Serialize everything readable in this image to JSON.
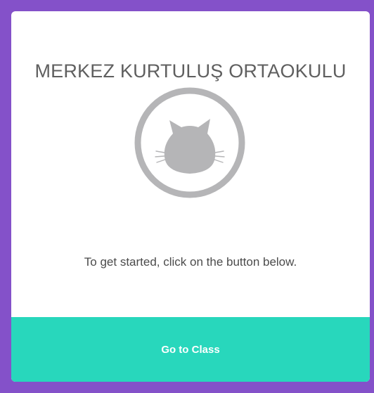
{
  "card": {
    "school_name": "MERKEZ KURTULUŞ ORTAOKULU",
    "avatar_icon": "cat-avatar-icon",
    "instruction": "To get started, click on the button below.",
    "button_label": "Go to Class"
  },
  "colors": {
    "background": "#8451c9",
    "card": "#ffffff",
    "button": "#28d7bc",
    "avatar_gray": "#b5b5b7"
  }
}
